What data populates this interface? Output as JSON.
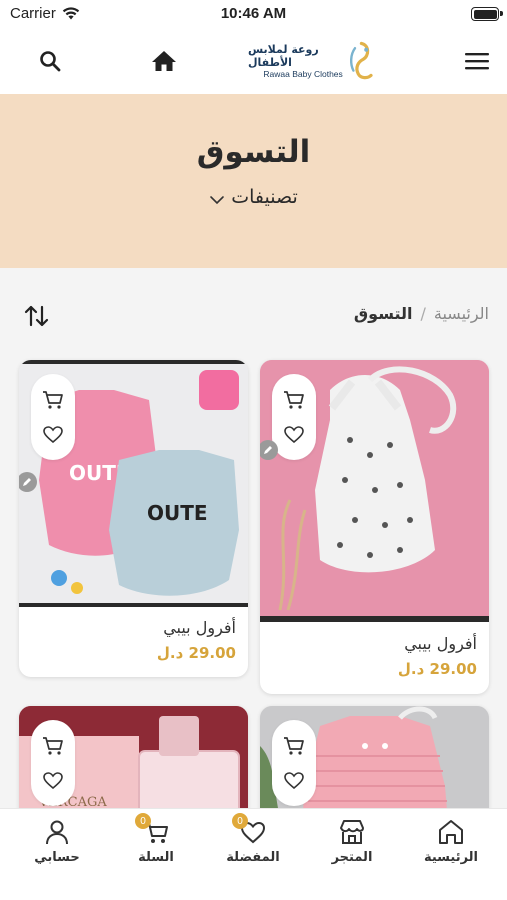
{
  "status_bar": {
    "carrier": "Carrier",
    "time": "10:46 AM"
  },
  "header": {
    "logo_ar": "روعة لملابس الأطفال",
    "logo_en": "Rawaa Baby Clothes"
  },
  "banner": {
    "title": "التسوق",
    "categories_label": "تصنيفات"
  },
  "breadcrumb": {
    "home": "الرئيسية",
    "separator": "/",
    "current": "التسوق"
  },
  "products": [
    {
      "name": "أفرول بيبي",
      "price": "29.00 د.ل"
    },
    {
      "name": "أفرول بيبي",
      "price": "29.00 د.ل"
    }
  ],
  "tabbar": {
    "home": "الرئيسية",
    "store": "المتجر",
    "favorites": "المفضلة",
    "favorites_badge": "0",
    "cart": "السلة",
    "cart_badge": "0",
    "account": "حسابي"
  },
  "colors": {
    "accent": "#d6a43b",
    "banner_bg": "#f4dcc2",
    "badge": "#e0a93a"
  }
}
